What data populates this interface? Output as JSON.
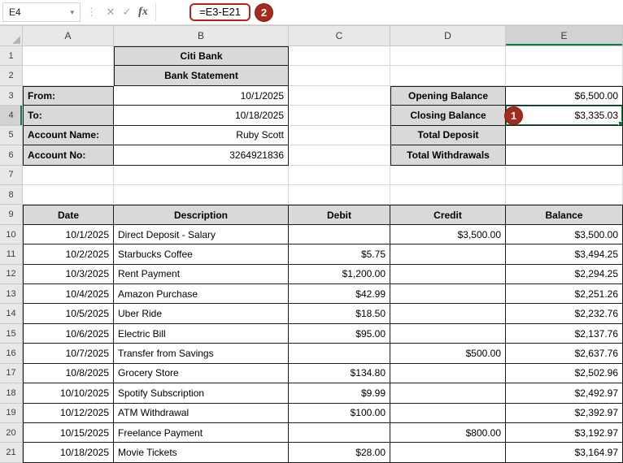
{
  "formula_bar": {
    "name_box_value": "E4",
    "formula": "=E3-E21"
  },
  "icons": {
    "chevron_down": "▾",
    "dots": "⋮",
    "cancel": "✕",
    "check": "✓",
    "fx": "fx"
  },
  "annotations": {
    "badge_formula": "2",
    "badge_cell": "1"
  },
  "selection": {
    "cell_ref": "E4",
    "column": "E",
    "row": 4
  },
  "colors": {
    "table_header_fill": "#d9d9d9",
    "selection_green": "#107c41",
    "annotation_red": "#a32a1c"
  },
  "sheet": {
    "column_headers": [
      "A",
      "B",
      "C",
      "D",
      "E"
    ],
    "rows": [
      {
        "n": 1,
        "cells": [
          {
            "col": "B",
            "text": "Citi Bank",
            "style": "head"
          }
        ]
      },
      {
        "n": 2,
        "cells": [
          {
            "col": "B",
            "text": "Bank Statement",
            "style": "head"
          }
        ]
      },
      {
        "n": 3,
        "cells": [
          {
            "col": "A",
            "text": "From:",
            "style": "label"
          },
          {
            "col": "B",
            "text": "10/1/2025",
            "style": "num"
          },
          {
            "col": "D",
            "text": "Opening Balance",
            "style": "head"
          },
          {
            "col": "E",
            "text": "$6,500.00",
            "style": "num"
          }
        ]
      },
      {
        "n": 4,
        "cells": [
          {
            "col": "A",
            "text": "To:",
            "style": "label"
          },
          {
            "col": "B",
            "text": "10/18/2025",
            "style": "num"
          },
          {
            "col": "D",
            "text": "Closing Balance",
            "style": "head"
          },
          {
            "col": "E",
            "text": "$3,335.03",
            "style": "num"
          }
        ]
      },
      {
        "n": 5,
        "cells": [
          {
            "col": "A",
            "text": "Account Name:",
            "style": "label"
          },
          {
            "col": "B",
            "text": "Ruby Scott",
            "style": "num"
          },
          {
            "col": "D",
            "text": "Total Deposit",
            "style": "head"
          }
        ]
      },
      {
        "n": 6,
        "cells": [
          {
            "col": "A",
            "text": "Account No:",
            "style": "label"
          },
          {
            "col": "B",
            "text": "3264921836",
            "style": "num"
          },
          {
            "col": "D",
            "text": "Total Withdrawals",
            "style": "head"
          }
        ]
      },
      {
        "n": 7,
        "cells": []
      },
      {
        "n": 8,
        "cells": []
      },
      {
        "n": 9,
        "cells": [
          {
            "col": "A",
            "text": "Date",
            "style": "head"
          },
          {
            "col": "B",
            "text": "Description",
            "style": "head"
          },
          {
            "col": "C",
            "text": "Debit",
            "style": "head"
          },
          {
            "col": "D",
            "text": "Credit",
            "style": "head"
          },
          {
            "col": "E",
            "text": "Balance",
            "style": "head"
          }
        ]
      },
      {
        "n": 10,
        "cells": [
          {
            "col": "A",
            "text": "10/1/2025",
            "style": "num"
          },
          {
            "col": "B",
            "text": "Direct Deposit - Salary",
            "style": "text"
          },
          {
            "col": "D",
            "text": "$3,500.00",
            "style": "num"
          },
          {
            "col": "E",
            "text": "$3,500.00",
            "style": "num"
          }
        ]
      },
      {
        "n": 11,
        "cells": [
          {
            "col": "A",
            "text": "10/2/2025",
            "style": "num"
          },
          {
            "col": "B",
            "text": "Starbucks Coffee",
            "style": "text"
          },
          {
            "col": "C",
            "text": "$5.75",
            "style": "num"
          },
          {
            "col": "E",
            "text": "$3,494.25",
            "style": "num"
          }
        ]
      },
      {
        "n": 12,
        "cells": [
          {
            "col": "A",
            "text": "10/3/2025",
            "style": "num"
          },
          {
            "col": "B",
            "text": "Rent Payment",
            "style": "text"
          },
          {
            "col": "C",
            "text": "$1,200.00",
            "style": "num"
          },
          {
            "col": "E",
            "text": "$2,294.25",
            "style": "num"
          }
        ]
      },
      {
        "n": 13,
        "cells": [
          {
            "col": "A",
            "text": "10/4/2025",
            "style": "num"
          },
          {
            "col": "B",
            "text": "Amazon Purchase",
            "style": "text"
          },
          {
            "col": "C",
            "text": "$42.99",
            "style": "num"
          },
          {
            "col": "E",
            "text": "$2,251.26",
            "style": "num"
          }
        ]
      },
      {
        "n": 14,
        "cells": [
          {
            "col": "A",
            "text": "10/5/2025",
            "style": "num"
          },
          {
            "col": "B",
            "text": "Uber Ride",
            "style": "text"
          },
          {
            "col": "C",
            "text": "$18.50",
            "style": "num"
          },
          {
            "col": "E",
            "text": "$2,232.76",
            "style": "num"
          }
        ]
      },
      {
        "n": 15,
        "cells": [
          {
            "col": "A",
            "text": "10/6/2025",
            "style": "num"
          },
          {
            "col": "B",
            "text": "Electric Bill",
            "style": "text"
          },
          {
            "col": "C",
            "text": "$95.00",
            "style": "num"
          },
          {
            "col": "E",
            "text": "$2,137.76",
            "style": "num"
          }
        ]
      },
      {
        "n": 16,
        "cells": [
          {
            "col": "A",
            "text": "10/7/2025",
            "style": "num"
          },
          {
            "col": "B",
            "text": "Transfer from Savings",
            "style": "text"
          },
          {
            "col": "D",
            "text": "$500.00",
            "style": "num"
          },
          {
            "col": "E",
            "text": "$2,637.76",
            "style": "num"
          }
        ]
      },
      {
        "n": 17,
        "cells": [
          {
            "col": "A",
            "text": "10/8/2025",
            "style": "num"
          },
          {
            "col": "B",
            "text": "Grocery Store",
            "style": "text"
          },
          {
            "col": "C",
            "text": "$134.80",
            "style": "num"
          },
          {
            "col": "E",
            "text": "$2,502.96",
            "style": "num"
          }
        ]
      },
      {
        "n": 18,
        "cells": [
          {
            "col": "A",
            "text": "10/10/2025",
            "style": "num"
          },
          {
            "col": "B",
            "text": "Spotify Subscription",
            "style": "text"
          },
          {
            "col": "C",
            "text": "$9.99",
            "style": "num"
          },
          {
            "col": "E",
            "text": "$2,492.97",
            "style": "num"
          }
        ]
      },
      {
        "n": 19,
        "cells": [
          {
            "col": "A",
            "text": "10/12/2025",
            "style": "num"
          },
          {
            "col": "B",
            "text": "ATM Withdrawal",
            "style": "text"
          },
          {
            "col": "C",
            "text": "$100.00",
            "style": "num"
          },
          {
            "col": "E",
            "text": "$2,392.97",
            "style": "num"
          }
        ]
      },
      {
        "n": 20,
        "cells": [
          {
            "col": "A",
            "text": "10/15/2025",
            "style": "num"
          },
          {
            "col": "B",
            "text": "Freelance Payment",
            "style": "text"
          },
          {
            "col": "D",
            "text": "$800.00",
            "style": "num"
          },
          {
            "col": "E",
            "text": "$3,192.97",
            "style": "num"
          }
        ]
      },
      {
        "n": 21,
        "cells": [
          {
            "col": "A",
            "text": "10/18/2025",
            "style": "num"
          },
          {
            "col": "B",
            "text": "Movie Tickets",
            "style": "text"
          },
          {
            "col": "C",
            "text": "$28.00",
            "style": "num"
          },
          {
            "col": "E",
            "text": "$3,164.97",
            "style": "num"
          }
        ]
      }
    ]
  }
}
